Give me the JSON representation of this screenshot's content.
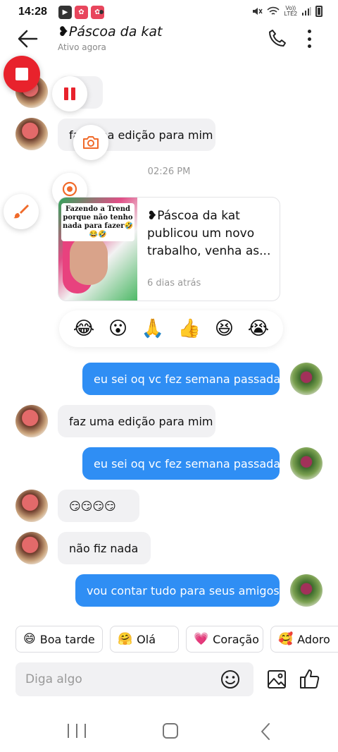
{
  "status_bar": {
    "time": "14:28",
    "network_top": "Vo))",
    "network_bottom": "LTE2"
  },
  "header": {
    "title": "❥Páscoa da kat",
    "subtitle": "Ativo agora"
  },
  "messages": [
    {
      "side": "them",
      "text": "oii"
    },
    {
      "side": "them",
      "text": "faz uma edição para mim"
    }
  ],
  "timestamp": "02:26 PM",
  "shared_post": {
    "thumbnail_caption": "Fazendo a Trend porque não tenho nada para fazer🤣😂🤣",
    "text": "❥Páscoa da kat publicou um novo trabalho, venha as...",
    "meta": "6 dias atrás"
  },
  "reactions": [
    "😂",
    "😮",
    "🙏",
    "👍",
    "😆",
    "😭"
  ],
  "conversation": [
    {
      "side": "me",
      "text": "eu sei oq vc fez semana passada"
    },
    {
      "side": "them",
      "text": "faz uma edição para mim"
    },
    {
      "side": "me",
      "text": "eu sei oq vc fez semana passada"
    },
    {
      "side": "them",
      "text": "😏😏😏😏"
    },
    {
      "side": "them",
      "text": "não fiz nada"
    },
    {
      "side": "me",
      "text": "vou contar tudo para seus amigos"
    }
  ],
  "quick_replies": [
    {
      "emoji": "😄",
      "label": "Boa tarde"
    },
    {
      "emoji": "🤗",
      "label": "Olá"
    },
    {
      "emoji": "💗",
      "label": "Coração"
    },
    {
      "emoji": "🥰",
      "label": "Adoro"
    }
  ],
  "composer": {
    "placeholder": "Diga algo",
    "value": ""
  },
  "colors": {
    "my_bubble": "#2f8ef4",
    "their_bubble": "#f1f1f3",
    "record_button": "#e8222c"
  }
}
